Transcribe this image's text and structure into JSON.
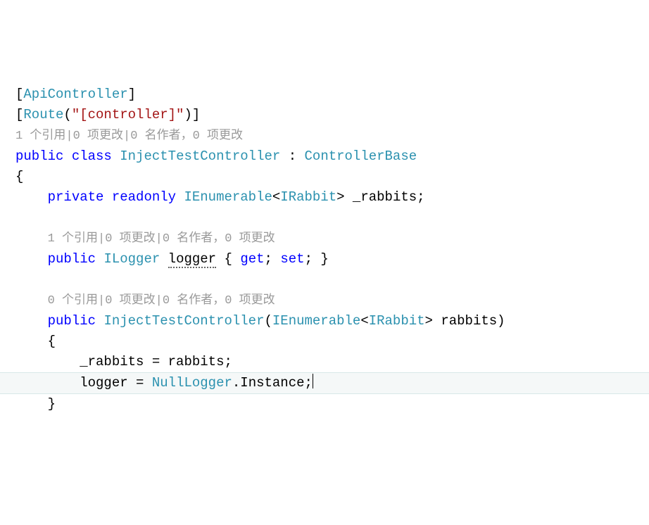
{
  "code": {
    "attr1_open": "[",
    "attr1_type": "ApiController",
    "attr1_close": "]",
    "attr2_open": "[",
    "attr2_type": "Route",
    "attr2_paren_open": "(",
    "attr2_string": "\"[controller]\"",
    "attr2_paren_close": ")",
    "attr2_close": "]",
    "lens1": "1 个引用|0 项更改|0 名作者，0 项更改",
    "kw_public": "public",
    "kw_class": "class",
    "class_name": "InjectTestController",
    "colon": " : ",
    "base_class": "ControllerBase",
    "brace_open": "{",
    "kw_private": "private",
    "kw_readonly": "readonly",
    "type_ienum": "IEnumerable",
    "lt": "<",
    "type_irabbit": "IRabbit",
    "gt": ">",
    "field_rabbits": " _rabbits",
    "semicolon": ";",
    "lens2": "1 个引用|0 项更改|0 名作者，0 项更改",
    "type_ilogger": "ILogger",
    "prop_logger": "logger",
    "prop_open": " { ",
    "kw_get": "get",
    "sep": "; ",
    "kw_set": "set",
    "prop_close": "; }",
    "lens3": "0 个引用|0 项更改|0 名作者，0 项更改",
    "ctor_name": "InjectTestController",
    "ctor_paren_open": "(",
    "param_name": " rabbits",
    "ctor_paren_close": ")",
    "ctor_brace_open": "{",
    "assign1_lhs": "_rabbits",
    "assign_eq": " = ",
    "assign1_rhs": "rabbits",
    "assign2_lhs": "logger",
    "type_nulllogger": "NullLogger",
    "dot": ".",
    "member_instance": "Instance",
    "ctor_brace_close": "}"
  }
}
